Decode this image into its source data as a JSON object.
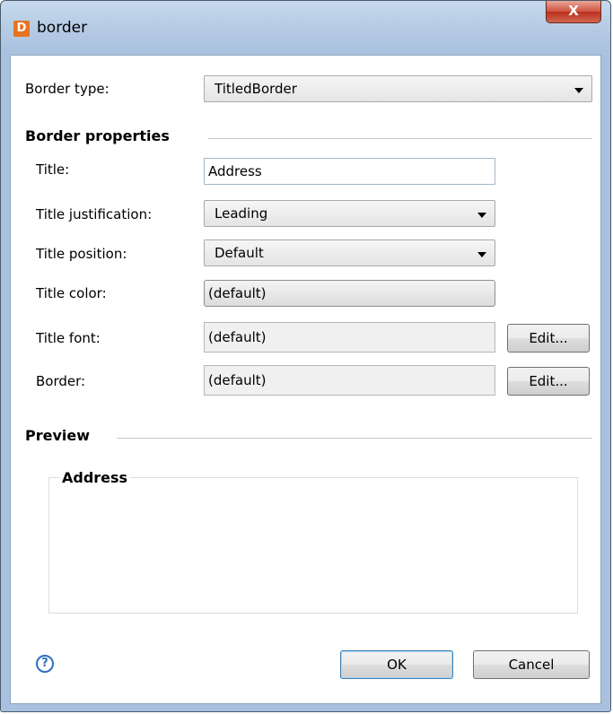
{
  "window": {
    "title": "border",
    "app_icon": "D",
    "close_glyph": "X"
  },
  "border_type": {
    "label": "Border type:",
    "value": "TitledBorder"
  },
  "border_properties": {
    "heading": "Border properties",
    "title": {
      "label": "Title:",
      "value": "Address"
    },
    "justification": {
      "label": "Title justification:",
      "value": "Leading"
    },
    "position": {
      "label": "Title position:",
      "value": "Default"
    },
    "color": {
      "label": "Title color:",
      "value": "(default)"
    },
    "font": {
      "label": "Title font:",
      "value": "(default)",
      "button": "Edit..."
    },
    "border": {
      "label": "Border:",
      "value": "(default)",
      "button": "Edit..."
    }
  },
  "preview": {
    "heading": "Preview",
    "title": "Address"
  },
  "footer": {
    "help_glyph": "?",
    "ok": "OK",
    "cancel": "Cancel"
  }
}
